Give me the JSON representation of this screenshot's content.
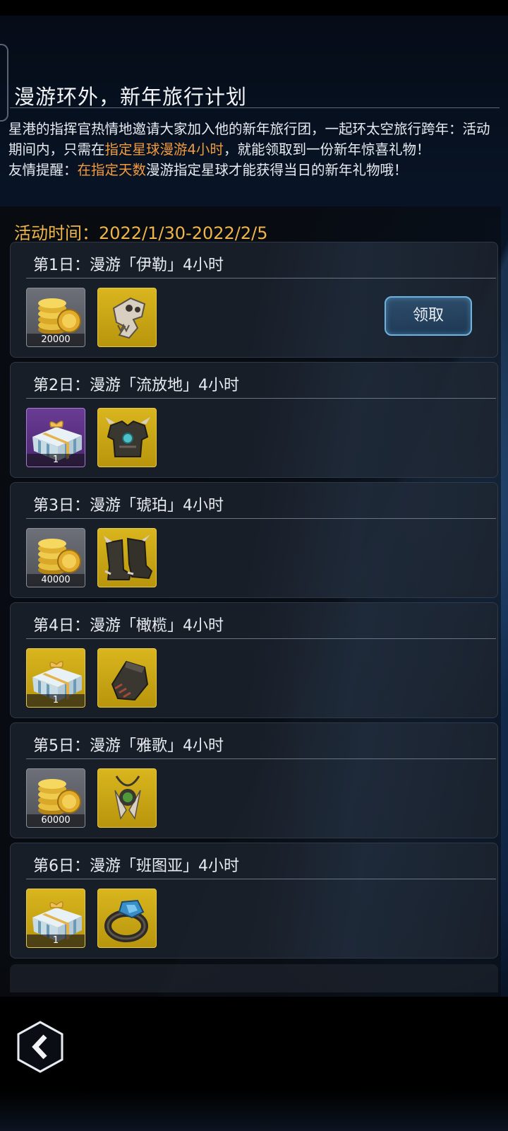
{
  "header": {
    "title": "漫游环外，新年旅行计划"
  },
  "intro": {
    "line1": "星港的指挥官热情地邀请大家加入他的新年旅行团，一起环太空旅行跨年：活动期间内，只需在",
    "highlight1": "指定星球漫游4小时",
    "line2": "，就能领取到一份新年惊喜礼物！",
    "tip_prefix": "友情提醒：",
    "highlight2": "在指定天数",
    "tip_suffix": "漫游指定星球才能获得当日的新年礼物哦！"
  },
  "event_time": "活动时间：2022/1/30-2022/2/5",
  "days": [
    {
      "title": "第1日：漫游「伊勒」4小时",
      "item1": {
        "icon": "gold-coins-icon",
        "qty": "20000"
      },
      "item2": {
        "icon": "beast-skull-icon"
      },
      "claim_label": "领取"
    },
    {
      "title": "第2日：漫游「流放地」4小时",
      "item1": {
        "icon": "gift-box-icon",
        "qty": "1"
      },
      "item2": {
        "icon": "chest-armor-icon"
      }
    },
    {
      "title": "第3日：漫游「琥珀」4小时",
      "item1": {
        "icon": "gold-coins-icon",
        "qty": "40000"
      },
      "item2": {
        "icon": "boots-icon"
      }
    },
    {
      "title": "第4日：漫游「橄榄」4小时",
      "item1": {
        "icon": "gift-box-icon",
        "qty": "1"
      },
      "item2": {
        "icon": "gauntlet-icon"
      }
    },
    {
      "title": "第5日：漫游「雅歌」4小时",
      "item1": {
        "icon": "gold-coins-icon",
        "qty": "60000"
      },
      "item2": {
        "icon": "amulet-icon"
      }
    },
    {
      "title": "第6日：漫游「班图亚」4小时",
      "item1": {
        "icon": "gift-box-icon",
        "qty": "1"
      },
      "item2": {
        "icon": "gem-ring-icon"
      }
    }
  ],
  "nav": {
    "back_icon": "back-arrow-icon"
  }
}
